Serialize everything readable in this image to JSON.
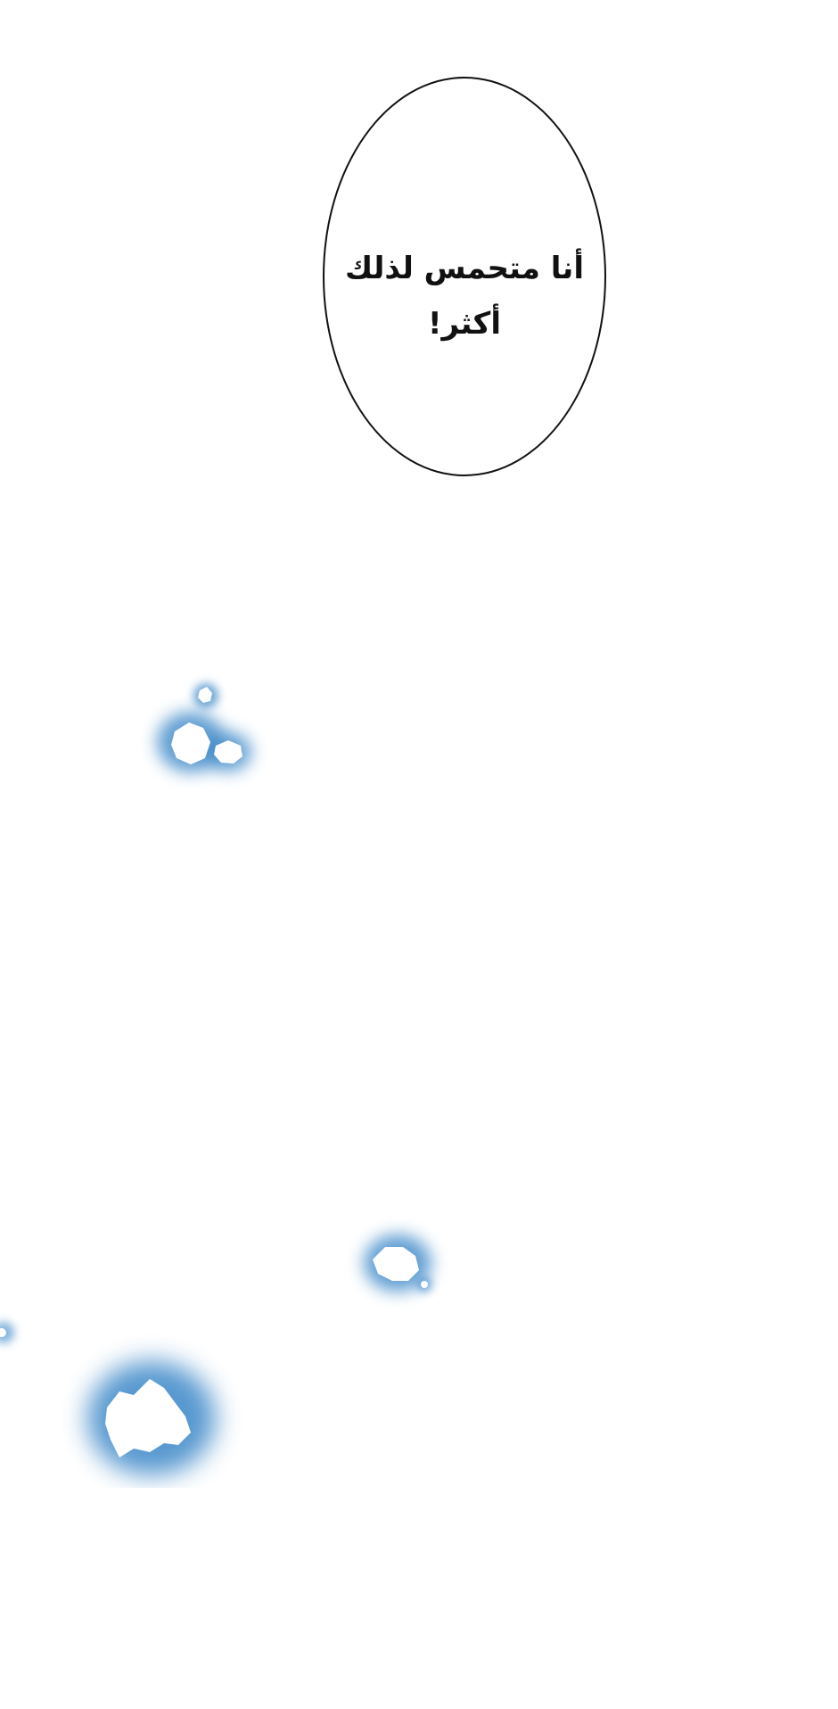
{
  "speech_bubble": {
    "line_1": "أنا متحمس لذلك",
    "line_2": "أكثر!"
  },
  "colors": {
    "background": "#ffffff",
    "bubble_outline": "#111111",
    "glow": "#2f7fc4"
  },
  "effects": {
    "type": "glowing-snowflakes"
  }
}
